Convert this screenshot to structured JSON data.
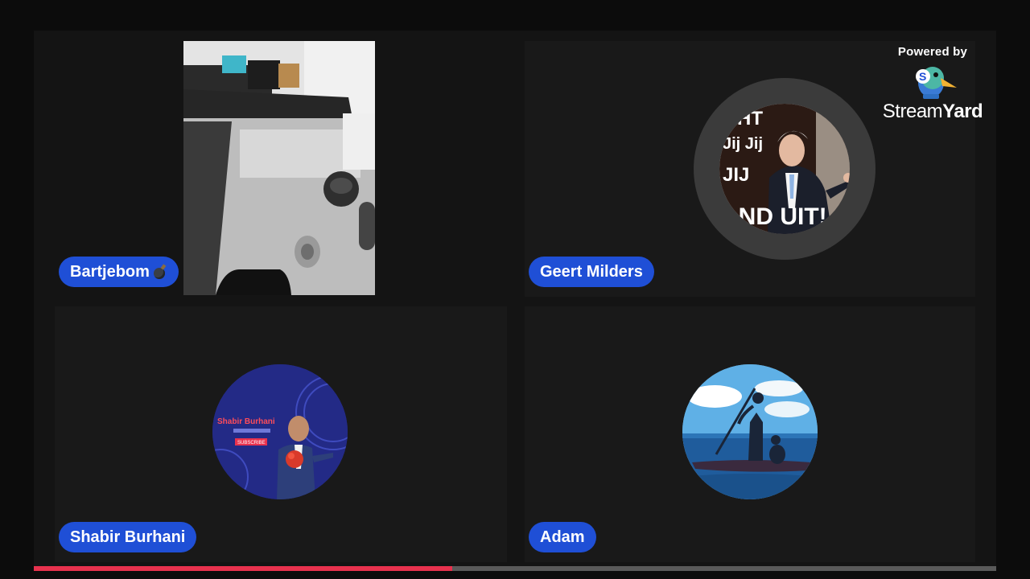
{
  "participants": [
    {
      "name": "Bartjebom",
      "has_emoji": true
    },
    {
      "name": "Geert Milders"
    },
    {
      "name": "Shabir Burhani"
    },
    {
      "name": "Adam"
    }
  ],
  "avatar_geert": {
    "line1": "ICHT",
    "line2": "Jij  Jij",
    "line3": "JIJ",
    "line4": "AND UIT!"
  },
  "avatar_shabir": {
    "title": "Shabir Burhani",
    "subscribe": "SUBSCRIBE"
  },
  "watermark": {
    "powered_by": "Powered by",
    "brand_part1": "Stream",
    "brand_part2": "Yard"
  },
  "playback": {
    "progress": 0.435
  },
  "colors": {
    "name_tag": "#1f4fd6",
    "progress": "#e8324e",
    "background": "#141414"
  }
}
